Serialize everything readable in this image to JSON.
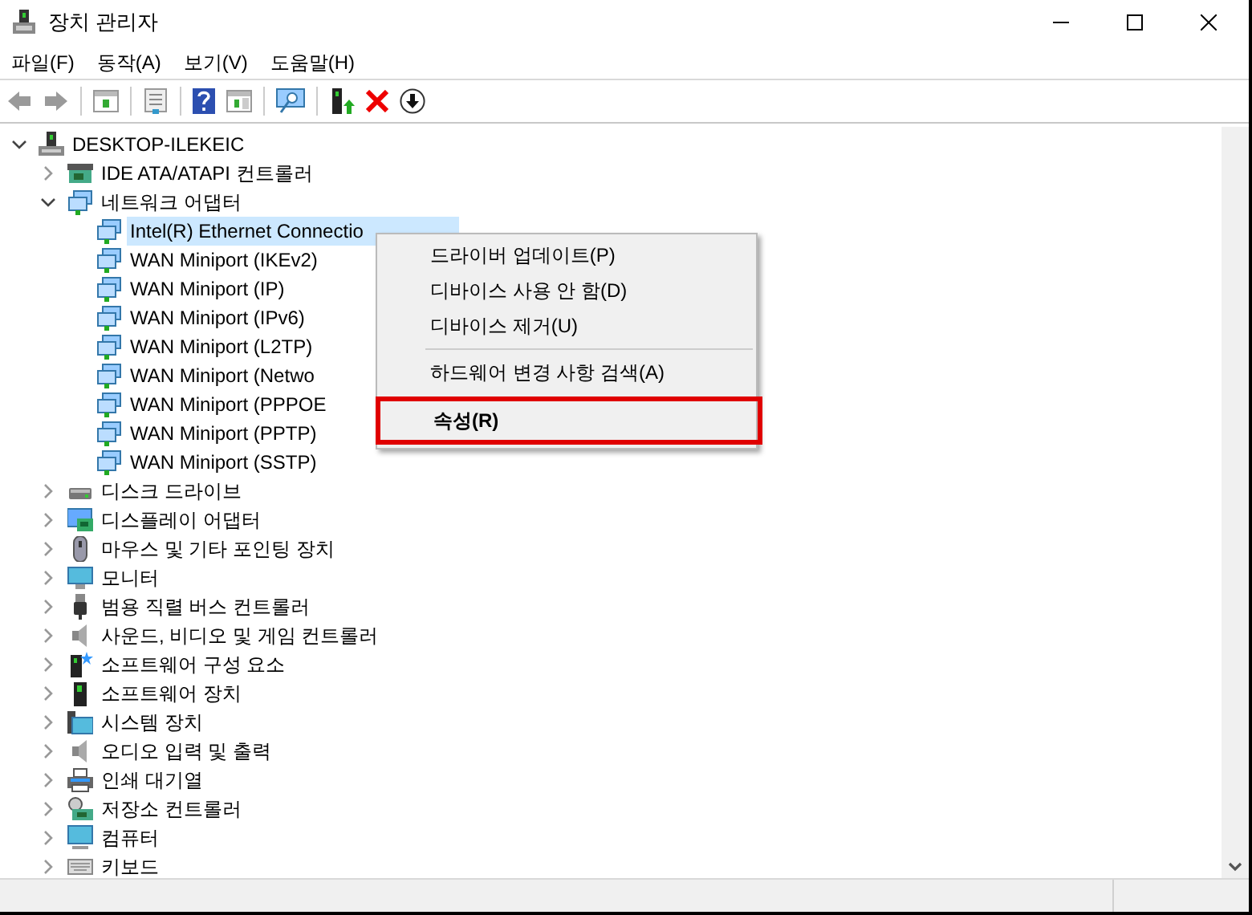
{
  "window": {
    "title": "장치 관리자"
  },
  "menu_bar": [
    "파일(F)",
    "동작(A)",
    "보기(V)",
    "도움말(H)"
  ],
  "tree": {
    "label": "DESKTOP-ILEKEIC",
    "expanded": true,
    "selected": false,
    "children": [
      {
        "label": "IDE ATA/ATAPI 컨트롤러",
        "expanded": false,
        "selected": false
      },
      {
        "label": "네트워크 어댑터",
        "expanded": true,
        "selected": false,
        "children": [
          {
            "label": "Intel(R) Ethernet Connectio",
            "selected": true
          },
          {
            "label": "WAN Miniport (IKEv2)",
            "selected": false
          },
          {
            "label": "WAN Miniport (IP)",
            "selected": false
          },
          {
            "label": "WAN Miniport (IPv6)",
            "selected": false
          },
          {
            "label": "WAN Miniport (L2TP)",
            "selected": false
          },
          {
            "label": "WAN Miniport (Netwo",
            "selected": false
          },
          {
            "label": "WAN Miniport (PPPOE",
            "selected": false
          },
          {
            "label": "WAN Miniport (PPTP)",
            "selected": false
          },
          {
            "label": "WAN Miniport (SSTP)",
            "selected": false
          }
        ]
      },
      {
        "label": "디스크 드라이브",
        "expanded": false,
        "selected": false
      },
      {
        "label": "디스플레이 어댑터",
        "expanded": false,
        "selected": false
      },
      {
        "label": "마우스 및 기타 포인팅 장치",
        "expanded": false,
        "selected": false
      },
      {
        "label": "모니터",
        "expanded": false,
        "selected": false
      },
      {
        "label": "범용 직렬 버스 컨트롤러",
        "expanded": false,
        "selected": false
      },
      {
        "label": "사운드, 비디오 및 게임 컨트롤러",
        "expanded": false,
        "selected": false
      },
      {
        "label": "소프트웨어 구성 요소",
        "expanded": false,
        "selected": false
      },
      {
        "label": "소프트웨어 장치",
        "expanded": false,
        "selected": false
      },
      {
        "label": "시스템 장치",
        "expanded": false,
        "selected": false
      },
      {
        "label": "오디오 입력 및 출력",
        "expanded": false,
        "selected": false
      },
      {
        "label": "인쇄 대기열",
        "expanded": false,
        "selected": false
      },
      {
        "label": "저장소 컨트롤러",
        "expanded": false,
        "selected": false
      },
      {
        "label": "컴퓨터",
        "expanded": false,
        "selected": false
      },
      {
        "label": "키보드",
        "expanded": false,
        "selected": false
      }
    ]
  },
  "context_menu": [
    {
      "kind": "item",
      "label": "드라이버 업데이트(P)",
      "bold": false,
      "highlighted": false
    },
    {
      "kind": "item",
      "label": "디바이스 사용 안 함(D)",
      "bold": false,
      "highlighted": false
    },
    {
      "kind": "item",
      "label": "디바이스 제거(U)",
      "bold": false,
      "highlighted": false
    },
    {
      "kind": "separator"
    },
    {
      "kind": "item",
      "label": "하드웨어 변경 사항 검색(A)",
      "bold": false,
      "highlighted": false
    },
    {
      "kind": "item",
      "label": "속성(R)",
      "bold": true,
      "highlighted": true
    }
  ]
}
